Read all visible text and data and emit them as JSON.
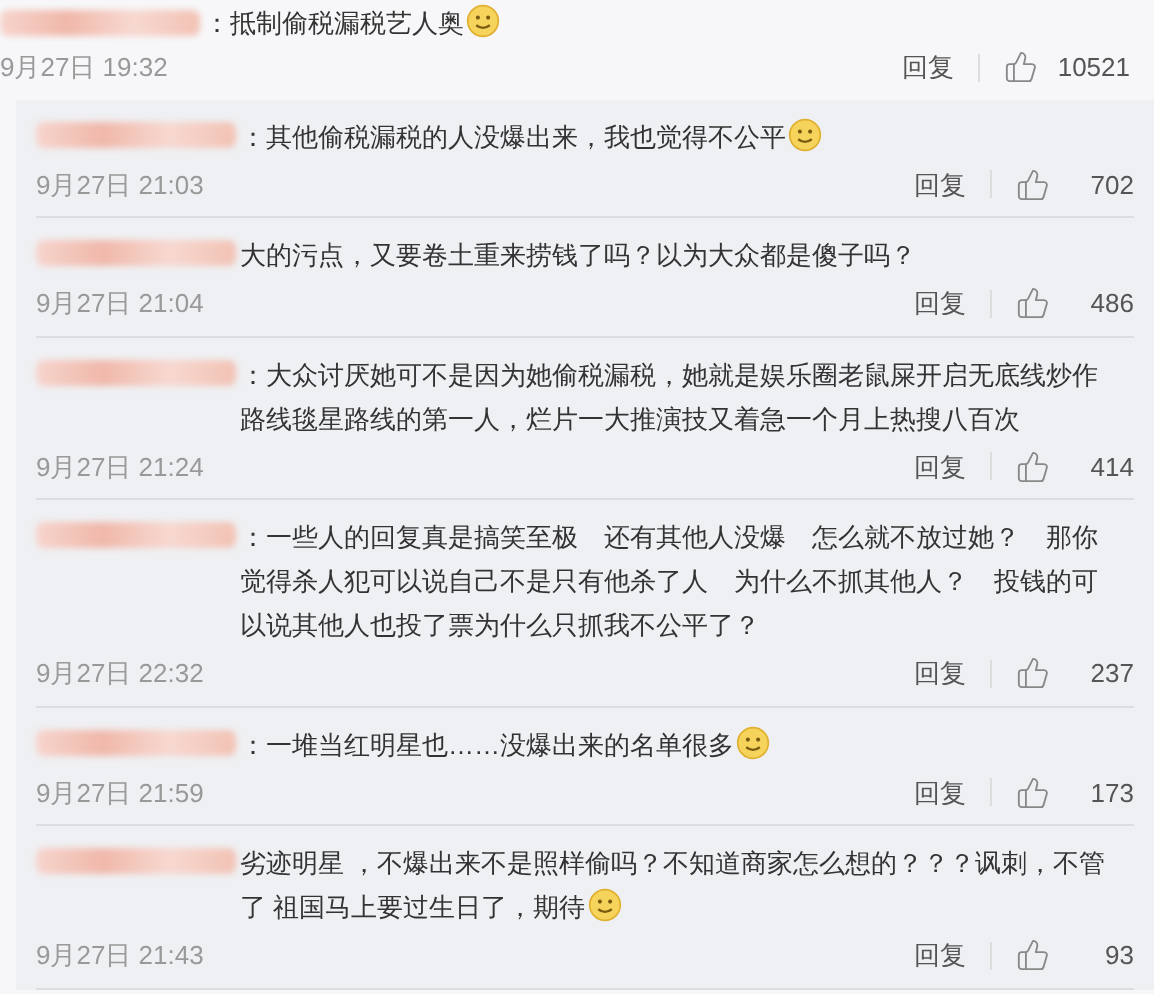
{
  "top_comment": {
    "text": "：抵制偷税漏税艺人奥",
    "emoji": true,
    "time": "9月27日 19:32",
    "reply_label": "回复",
    "likes": "10521"
  },
  "replies": [
    {
      "text": "：其他偷税漏税的人没爆出来，我也觉得不公平",
      "emoji": true,
      "time": "9月27日 21:03",
      "reply_label": "回复",
      "likes": "702"
    },
    {
      "text": "大的污点，又要卷土重来捞钱了吗？以为大众都是傻子吗？",
      "emoji": false,
      "time": "9月27日 21:04",
      "reply_label": "回复",
      "likes": "486"
    },
    {
      "text": "：大众讨厌她可不是因为她偷税漏税，她就是娱乐圈老鼠屎开启无底线炒作路线毯星路线的第一人，烂片一大推演技又着急一个月上热搜八百次",
      "emoji": false,
      "time": "9月27日 21:24",
      "reply_label": "回复",
      "likes": "414"
    },
    {
      "text": "：一些人的回复真是搞笑至极　还有其他人没爆　怎么就不放过她？　那你觉得杀人犯可以说自己不是只有他杀了人　为什么不抓其他人？　投钱的可以说其他人也投了票为什么只抓我不公平了？",
      "emoji": false,
      "time": "9月27日 22:32",
      "reply_label": "回复",
      "likes": "237"
    },
    {
      "text": "：一堆当红明星也……没爆出来的名单很多",
      "emoji": true,
      "time": "9月27日 21:59",
      "reply_label": "回复",
      "likes": "173"
    },
    {
      "text": "劣迹明星 ，不爆出来不是照样偷吗？不知道商家怎么想的？？？讽刺，不管了 祖国马上要过生日了，期待",
      "emoji": true,
      "time": "9月27日 21:43",
      "reply_label": "回复",
      "likes": "93"
    }
  ]
}
